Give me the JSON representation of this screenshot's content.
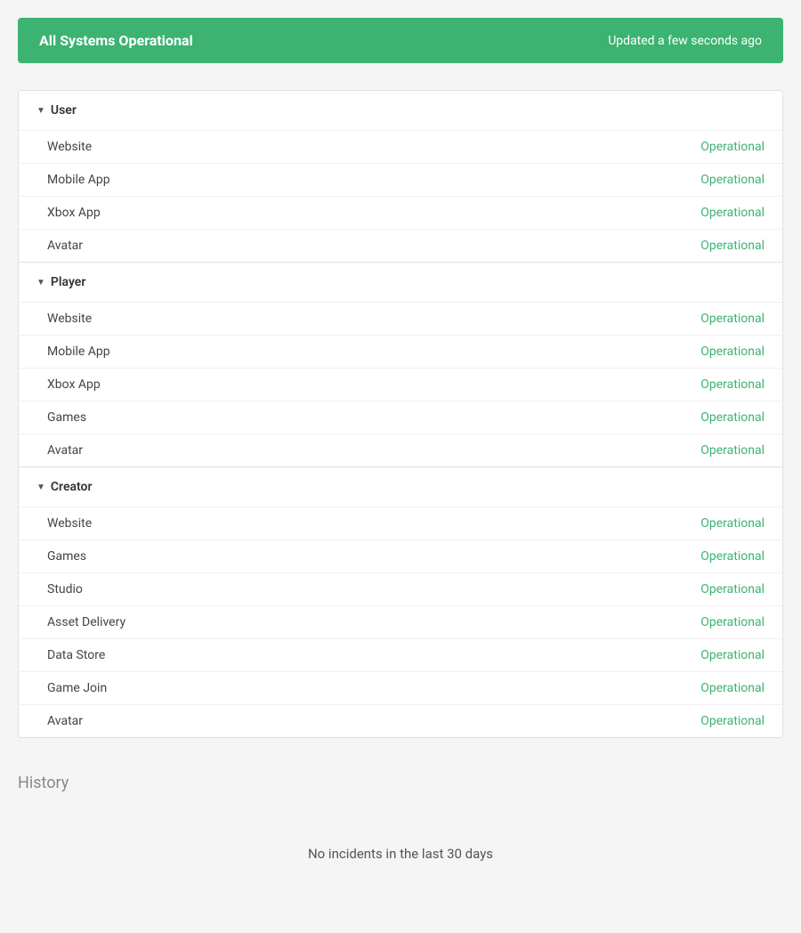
{
  "banner": {
    "title": "All Systems Operational",
    "updated": "Updated a few seconds ago",
    "color": "#3cb371"
  },
  "groups": [
    {
      "name": "User",
      "services": [
        {
          "name": "Website",
          "status": "Operational"
        },
        {
          "name": "Mobile App",
          "status": "Operational"
        },
        {
          "name": "Xbox App",
          "status": "Operational"
        },
        {
          "name": "Avatar",
          "status": "Operational"
        }
      ]
    },
    {
      "name": "Player",
      "services": [
        {
          "name": "Website",
          "status": "Operational"
        },
        {
          "name": "Mobile App",
          "status": "Operational"
        },
        {
          "name": "Xbox App",
          "status": "Operational"
        },
        {
          "name": "Games",
          "status": "Operational"
        },
        {
          "name": "Avatar",
          "status": "Operational"
        }
      ]
    },
    {
      "name": "Creator",
      "services": [
        {
          "name": "Website",
          "status": "Operational"
        },
        {
          "name": "Games",
          "status": "Operational"
        },
        {
          "name": "Studio",
          "status": "Operational"
        },
        {
          "name": "Asset Delivery",
          "status": "Operational"
        },
        {
          "name": "Data Store",
          "status": "Operational"
        },
        {
          "name": "Game Join",
          "status": "Operational"
        },
        {
          "name": "Avatar",
          "status": "Operational"
        }
      ]
    }
  ],
  "history": {
    "title": "History",
    "no_incidents": "No incidents in the last 30 days"
  }
}
